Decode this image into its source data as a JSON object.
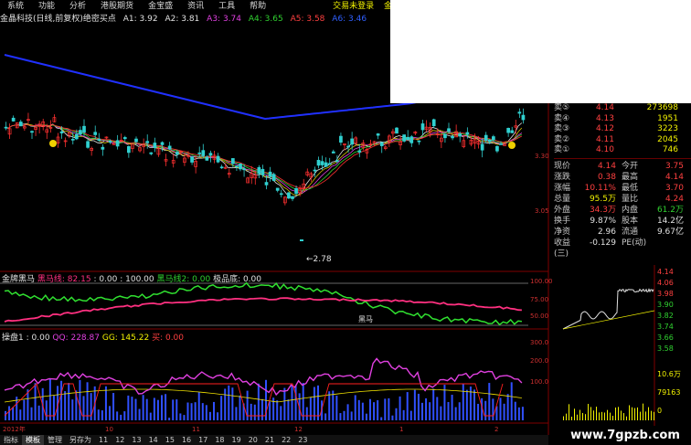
{
  "menu": [
    "系统",
    "功能",
    "分析",
    "港股期货",
    "金宝盛",
    "资讯",
    "工具",
    "帮助"
  ],
  "menu_right": [
    "交易未登录",
    "金晶科技"
  ],
  "info": {
    "title": "金晶科技(日线,前复权)绝密买点",
    "a1": "A1: 3.92",
    "a2": "A2: 3.81",
    "a3": "A3: 3.74",
    "a4": "A4: 3.65",
    "a5": "A5: 3.58",
    "a6": "A6: 3.46"
  },
  "price_axis": [
    "3.90",
    "3.30",
    "3.05"
  ],
  "low_label": "←2.78",
  "ind1": {
    "name": "金牌黑马",
    "l1": "黑马线: 82.15",
    "l2": ": 0.00",
    ":3": ": 100.00",
    "l4": "黑马线2: 0.00",
    "l5": "极品底: 0.00"
  },
  "ind1_axis": [
    "100.00",
    "75.00",
    "50.00"
  ],
  "ind1_tag": "黑马",
  "ind2": {
    "name": "操盘1",
    "l1": ": 0.00",
    "l2": "QQ: 228.87",
    "l3": "GG: 145.22",
    "l4": "买: 0.00"
  },
  "ind2_axis": [
    "300.0",
    "200.0",
    "100.0"
  ],
  "date_labels": [
    "2012年",
    "10",
    "11",
    "12",
    "1",
    "2"
  ],
  "quote": {
    "asks": [
      {
        "k": "卖⑤",
        "p": "4.14",
        "v": "273698"
      },
      {
        "k": "卖④",
        "p": "4.13",
        "v": "1951"
      },
      {
        "k": "卖③",
        "p": "4.12",
        "v": "3223"
      },
      {
        "k": "卖②",
        "p": "4.11",
        "v": "2045"
      },
      {
        "k": "卖①",
        "p": "4.10",
        "v": "746"
      }
    ],
    "stats": [
      {
        "l": "现价",
        "lv": "4.14",
        "r": "今开",
        "rv": "3.75"
      },
      {
        "l": "涨跌",
        "lv": "0.38",
        "r": "最高",
        "rv": "4.14"
      },
      {
        "l": "涨幅",
        "lv": "10.11%",
        "r": "最低",
        "rv": "3.70"
      },
      {
        "l": "总量",
        "lv": "95.5万",
        "r": "量比",
        "rv": "4.24"
      },
      {
        "l": "外盘",
        "lv": "34.3万",
        "r": "内盘",
        "rv": "61.2万"
      },
      {
        "l": "换手",
        "lv": "9.87%",
        "r": "股本",
        "rv": "14.2亿"
      },
      {
        "l": "净资",
        "lv": "2.96",
        "r": "流通",
        "rv": "9.67亿"
      },
      {
        "l": "收益(三)",
        "lv": "-0.129",
        "r": "PE(动)",
        "rv": ""
      }
    ],
    "mini_axis": [
      "4.14",
      "4.06",
      "3.98",
      "3.90",
      "3.82",
      "3.74",
      "3.66",
      "3.58"
    ],
    "mini_vol": [
      "10.6万",
      "79163",
      "0"
    ]
  },
  "bottom_tabs": [
    "指标",
    "模板",
    "管理",
    "另存为",
    "11",
    "12",
    "13",
    "14",
    "15",
    "16",
    "17",
    "18",
    "19",
    "20",
    "21",
    "22",
    "23"
  ],
  "watermark": "www.7gpzb.com"
}
